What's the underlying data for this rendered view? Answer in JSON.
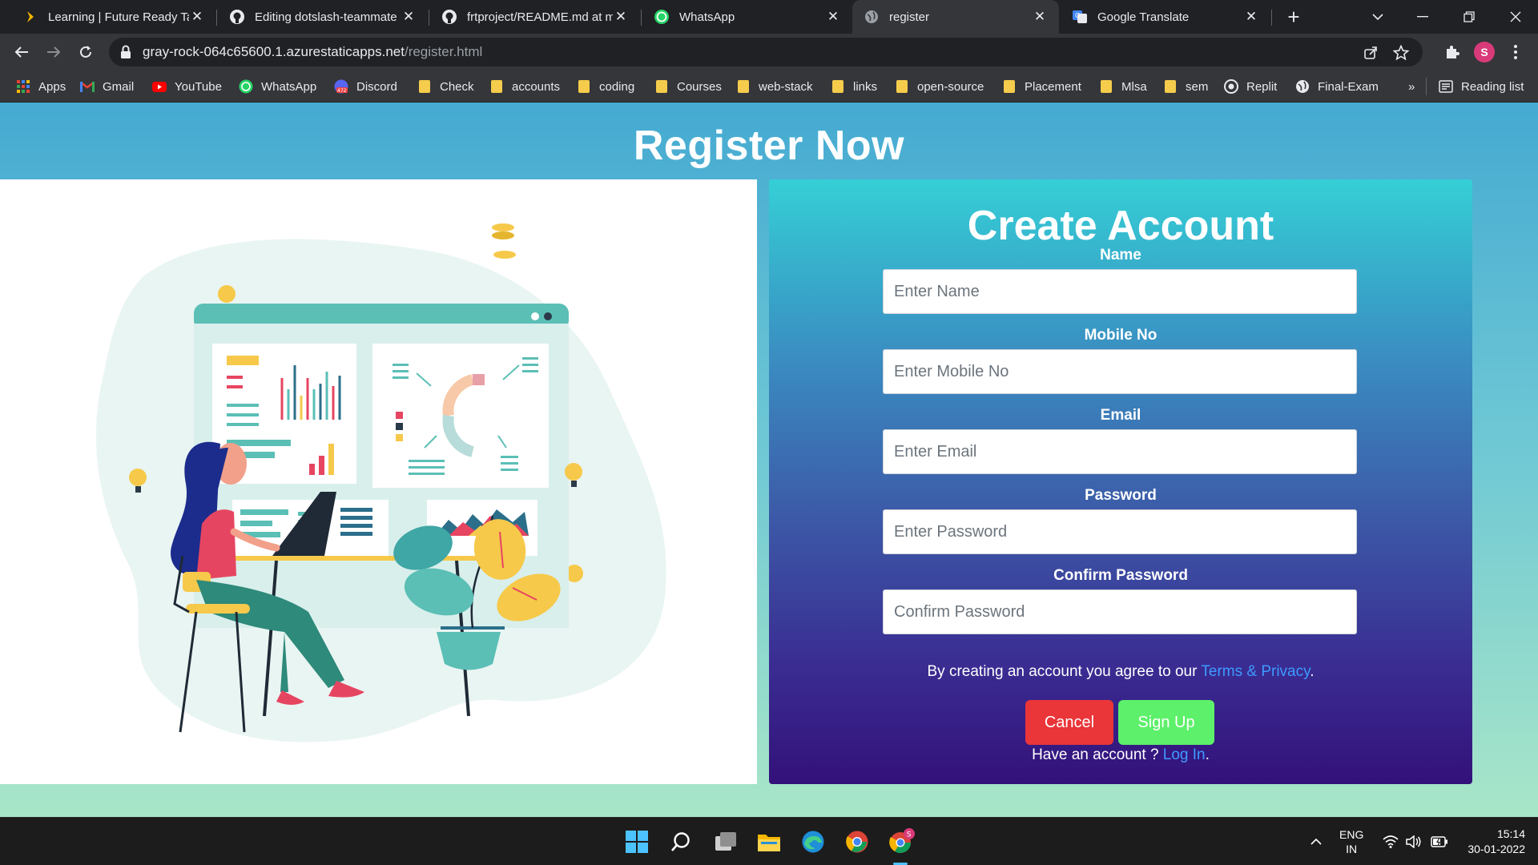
{
  "tabs": [
    {
      "title": "Learning | Future Ready Tale",
      "icon": "future-ready-icon",
      "active": false
    },
    {
      "title": "Editing dotslash-teammate",
      "icon": "github-icon",
      "active": false
    },
    {
      "title": "frtproject/README.md at m",
      "icon": "github-icon",
      "active": false
    },
    {
      "title": "WhatsApp",
      "icon": "whatsapp-icon",
      "active": false
    },
    {
      "title": "register",
      "icon": "globe-icon",
      "active": true
    },
    {
      "title": "Google Translate",
      "icon": "google-translate-icon",
      "active": false
    }
  ],
  "address_bar": {
    "domain": "gray-rock-064c65600.1.azurestaticapps.net",
    "path": "/register.html"
  },
  "profile_initial": "S",
  "bookmarks": [
    {
      "label": "Apps",
      "icon": "apps-grid-icon"
    },
    {
      "label": "Gmail",
      "icon": "gmail-icon"
    },
    {
      "label": "YouTube",
      "icon": "youtube-icon"
    },
    {
      "label": "WhatsApp",
      "icon": "whatsapp-icon"
    },
    {
      "label": "Discord",
      "icon": "discord-icon",
      "badge": "472"
    },
    {
      "label": "Check",
      "icon": "folder-icon"
    },
    {
      "label": "accounts",
      "icon": "folder-icon"
    },
    {
      "label": "coding",
      "icon": "folder-icon"
    },
    {
      "label": "Courses",
      "icon": "folder-icon"
    },
    {
      "label": "web-stack",
      "icon": "folder-icon"
    },
    {
      "label": "links",
      "icon": "folder-icon"
    },
    {
      "label": "open-source",
      "icon": "folder-icon"
    },
    {
      "label": "Placement",
      "icon": "folder-icon"
    },
    {
      "label": "Mlsa",
      "icon": "folder-icon"
    },
    {
      "label": "sem",
      "icon": "folder-icon"
    },
    {
      "label": "Replit",
      "icon": "replit-icon"
    },
    {
      "label": "Final-Exam",
      "icon": "globe-icon"
    }
  ],
  "bookmarks_overflow": "»",
  "reading_list": "Reading list",
  "page": {
    "heading": "Register Now",
    "form": {
      "title": "Create Account",
      "fields": [
        {
          "label": "Name",
          "placeholder": "Enter Name"
        },
        {
          "label": "Mobile No",
          "placeholder": "Enter Mobile No"
        },
        {
          "label": "Email",
          "placeholder": "Enter Email"
        },
        {
          "label": "Password",
          "placeholder": "Enter Password"
        },
        {
          "label": "Confirm Password",
          "placeholder": "Confirm Password"
        }
      ],
      "terms_prefix": "By creating an account you agree to our ",
      "terms_link": "Terms & Privacy",
      "terms_suffix": ".",
      "cancel_label": "Cancel",
      "signup_label": "Sign Up",
      "login_prefix": "Have an account ? ",
      "login_link": "Log In",
      "login_suffix": "."
    }
  },
  "taskbar": {
    "lang_top": "ENG",
    "lang_bottom": "IN",
    "time": "15:14",
    "date": "30-01-2022",
    "chrome_badge": "S"
  },
  "colors": {
    "page_gradient_top": "#45aad2",
    "page_gradient_bottom": "#a9e6c8",
    "cancel": "#ea3539",
    "signup": "#5df06a",
    "link": "#3e9bff"
  }
}
